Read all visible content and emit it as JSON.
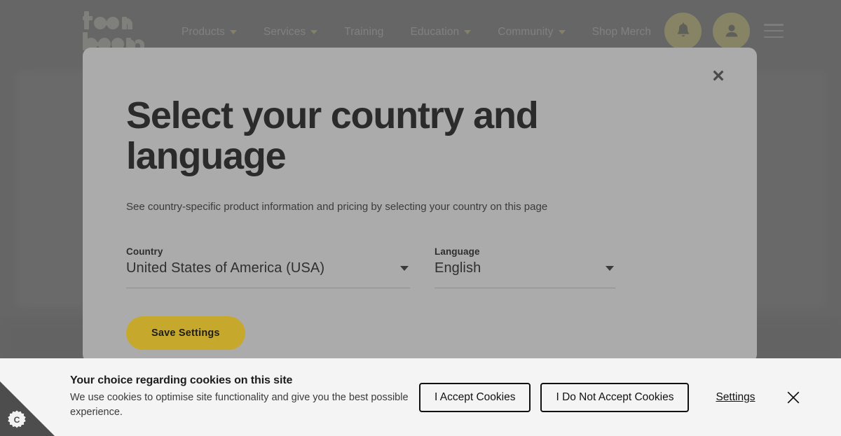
{
  "site": {
    "logo_text": "toon boom",
    "logo_line1": "toon",
    "logo_line2": "boom"
  },
  "nav": {
    "items": [
      {
        "label": "Products",
        "has_dropdown": true,
        "icon": "chevron-down-icon"
      },
      {
        "label": "Services",
        "has_dropdown": true,
        "icon": "chevron-down-icon"
      },
      {
        "label": "Training",
        "has_dropdown": false,
        "icon": ""
      },
      {
        "label": "Education",
        "has_dropdown": true,
        "icon": "chevron-down-icon"
      },
      {
        "label": "Community",
        "has_dropdown": true,
        "icon": "chevron-down-icon"
      },
      {
        "label": "Shop Merch",
        "has_dropdown": false,
        "icon": ""
      }
    ],
    "actions": {
      "notifications_icon": "bell-icon",
      "account_icon": "user-avatar-icon",
      "menu_icon": "hamburger-menu-icon"
    },
    "accent_color": "#d5cf9a",
    "link_color": "#c9c9c4"
  },
  "modal": {
    "title": "Select your country and language",
    "description": "See country-specific product information and pricing by selecting your country on this page",
    "close_icon": "close-x-icon",
    "fields": {
      "country": {
        "label": "Country",
        "value": "United States of America (USA)",
        "caret_icon": "chevron-down-icon"
      },
      "language": {
        "label": "Language",
        "value": "English",
        "caret_icon": "chevron-down-icon"
      }
    },
    "save_button": "Save Settings",
    "save_button_color": "#c6a92c",
    "background_color": "#ababab"
  },
  "cookie_banner": {
    "title": "Your choice regarding cookies on this site",
    "body": "We use cookies to optimise site functionality and give you the best possible experience.",
    "accept_label": "I Accept Cookies",
    "decline_label": "I Do Not Accept Cookies",
    "settings_label": "Settings",
    "close_icon": "close-x-icon",
    "background_color": "#f4f4f4"
  },
  "cookie_corner": {
    "icon": "cookie-settings-cog-icon",
    "glyph": "C",
    "background_color": "#4d4d4d"
  }
}
